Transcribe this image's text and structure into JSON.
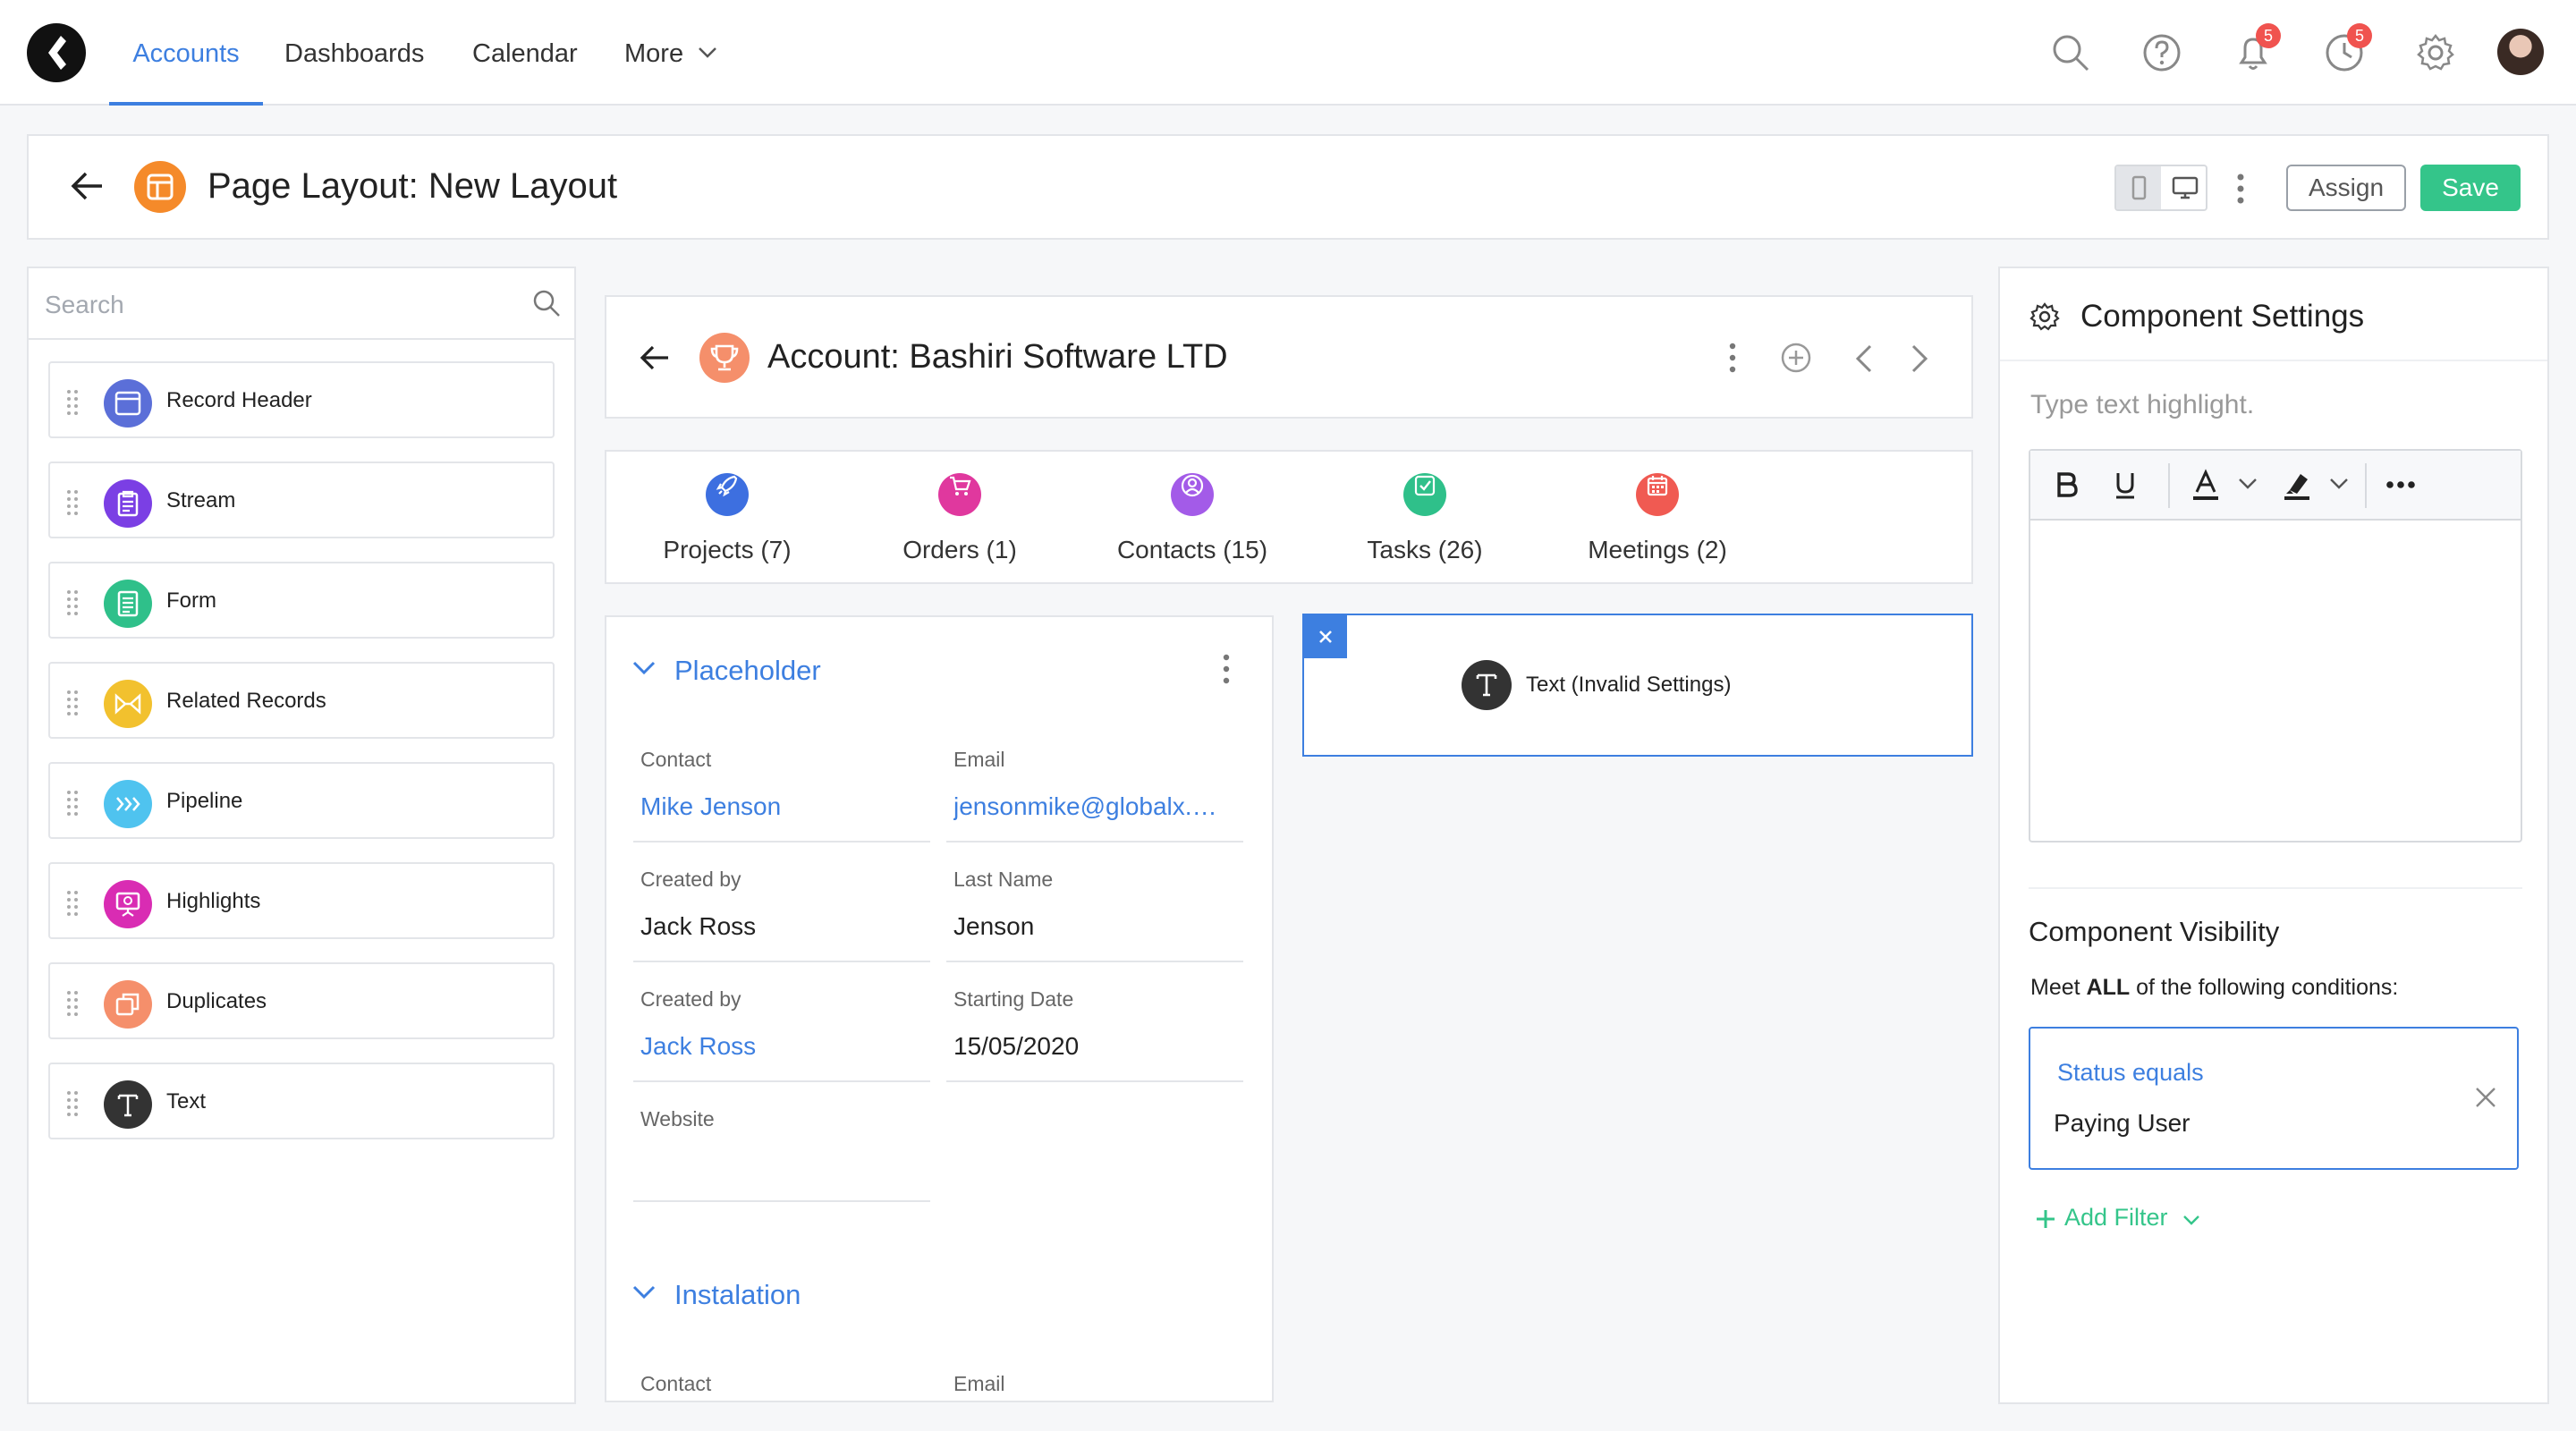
{
  "nav": {
    "tabs": [
      {
        "label": "Accounts"
      },
      {
        "label": "Dashboards"
      },
      {
        "label": "Calendar"
      },
      {
        "label": "More"
      }
    ],
    "notifications_count": "5",
    "activity_count": "5"
  },
  "page": {
    "title": "Page Layout: New Layout",
    "assign_label": "Assign",
    "save_label": "Save"
  },
  "left": {
    "search_placeholder": "Search",
    "components": [
      {
        "label": "Record Header",
        "color": "#5b6fd8",
        "icon": "window-icon"
      },
      {
        "label": "Stream",
        "color": "#7b3fe4",
        "icon": "clipboard-icon"
      },
      {
        "label": "Form",
        "color": "#2fc08a",
        "icon": "form-icon"
      },
      {
        "label": "Related Records",
        "color": "#f2c12e",
        "icon": "bowtie-icon"
      },
      {
        "label": "Pipeline",
        "color": "#4fc3ef",
        "icon": "pipeline-icon"
      },
      {
        "label": "Highlights",
        "color": "#d92cb3",
        "icon": "presentation-icon"
      },
      {
        "label": "Duplicates",
        "color": "#f58f6b",
        "icon": "duplicate-icon"
      },
      {
        "label": "Text",
        "color": "#333333",
        "icon": "text-icon"
      }
    ]
  },
  "record": {
    "title": "Account: Bashiri Software LTD",
    "tabs": [
      {
        "label": "Projects (7)",
        "color": "#3d6fe0"
      },
      {
        "label": "Orders (1)",
        "color": "#e0389e"
      },
      {
        "label": "Contacts (15)",
        "color": "#a35be8"
      },
      {
        "label": "Tasks (26)",
        "color": "#2fc08a"
      },
      {
        "label": "Meetings (2)",
        "color": "#f05a52"
      }
    ]
  },
  "placeholder": {
    "title": "Placeholder",
    "fields": [
      {
        "label": "Contact",
        "value": "Mike Jenson"
      },
      {
        "label": "Email",
        "value": "jensonmike@globalx.com"
      },
      {
        "label": "Created by",
        "value": "Jack Ross"
      },
      {
        "label": "Last Name",
        "value": "Jenson"
      },
      {
        "label": "Created by",
        "value": "Jack Ross"
      },
      {
        "label": "Starting Date",
        "value": "15/05/2020"
      },
      {
        "label": "Website",
        "value": ""
      }
    ]
  },
  "instalation": {
    "title": "Instalation",
    "contact_label": "Contact",
    "email_label": "Email"
  },
  "drop": {
    "label": "Text (Invalid Settings)"
  },
  "settings": {
    "title": "Component Settings",
    "highlight_placeholder": "Type text highlight.",
    "visibility_title": "Component Visibility",
    "meet_prefix": "Meet ",
    "meet_bold": "ALL",
    "meet_suffix": " of the following conditions:",
    "condition_field": "Status equals",
    "condition_value": "Paying User",
    "add_filter_label": "Add Filter"
  },
  "colors": {
    "accent": "#3d7fe0",
    "save": "#34c58a",
    "badge": "#f0534f"
  }
}
